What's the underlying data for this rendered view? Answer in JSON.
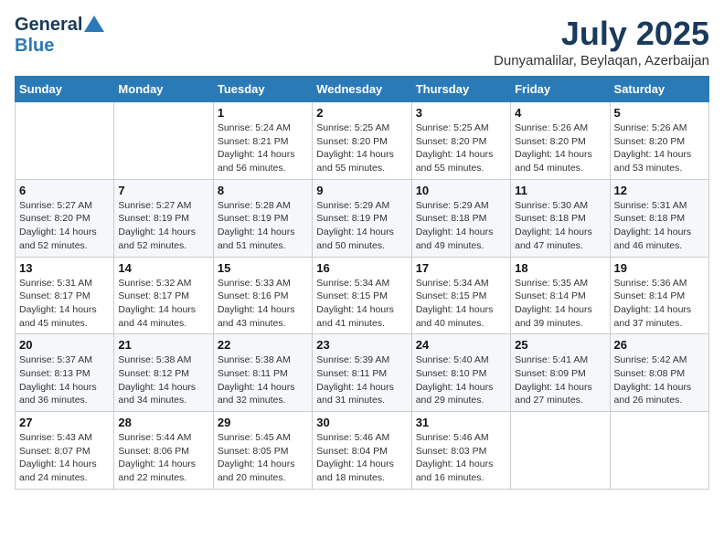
{
  "header": {
    "logo_general": "General",
    "logo_blue": "Blue",
    "month_title": "July 2025",
    "location": "Dunyamalilar, Beylaqan, Azerbaijan"
  },
  "columns": [
    "Sunday",
    "Monday",
    "Tuesday",
    "Wednesday",
    "Thursday",
    "Friday",
    "Saturday"
  ],
  "weeks": [
    [
      {
        "day": "",
        "info": ""
      },
      {
        "day": "",
        "info": ""
      },
      {
        "day": "1",
        "info": "Sunrise: 5:24 AM\nSunset: 8:21 PM\nDaylight: 14 hours and 56 minutes."
      },
      {
        "day": "2",
        "info": "Sunrise: 5:25 AM\nSunset: 8:20 PM\nDaylight: 14 hours and 55 minutes."
      },
      {
        "day": "3",
        "info": "Sunrise: 5:25 AM\nSunset: 8:20 PM\nDaylight: 14 hours and 55 minutes."
      },
      {
        "day": "4",
        "info": "Sunrise: 5:26 AM\nSunset: 8:20 PM\nDaylight: 14 hours and 54 minutes."
      },
      {
        "day": "5",
        "info": "Sunrise: 5:26 AM\nSunset: 8:20 PM\nDaylight: 14 hours and 53 minutes."
      }
    ],
    [
      {
        "day": "6",
        "info": "Sunrise: 5:27 AM\nSunset: 8:20 PM\nDaylight: 14 hours and 52 minutes."
      },
      {
        "day": "7",
        "info": "Sunrise: 5:27 AM\nSunset: 8:19 PM\nDaylight: 14 hours and 52 minutes."
      },
      {
        "day": "8",
        "info": "Sunrise: 5:28 AM\nSunset: 8:19 PM\nDaylight: 14 hours and 51 minutes."
      },
      {
        "day": "9",
        "info": "Sunrise: 5:29 AM\nSunset: 8:19 PM\nDaylight: 14 hours and 50 minutes."
      },
      {
        "day": "10",
        "info": "Sunrise: 5:29 AM\nSunset: 8:18 PM\nDaylight: 14 hours and 49 minutes."
      },
      {
        "day": "11",
        "info": "Sunrise: 5:30 AM\nSunset: 8:18 PM\nDaylight: 14 hours and 47 minutes."
      },
      {
        "day": "12",
        "info": "Sunrise: 5:31 AM\nSunset: 8:18 PM\nDaylight: 14 hours and 46 minutes."
      }
    ],
    [
      {
        "day": "13",
        "info": "Sunrise: 5:31 AM\nSunset: 8:17 PM\nDaylight: 14 hours and 45 minutes."
      },
      {
        "day": "14",
        "info": "Sunrise: 5:32 AM\nSunset: 8:17 PM\nDaylight: 14 hours and 44 minutes."
      },
      {
        "day": "15",
        "info": "Sunrise: 5:33 AM\nSunset: 8:16 PM\nDaylight: 14 hours and 43 minutes."
      },
      {
        "day": "16",
        "info": "Sunrise: 5:34 AM\nSunset: 8:15 PM\nDaylight: 14 hours and 41 minutes."
      },
      {
        "day": "17",
        "info": "Sunrise: 5:34 AM\nSunset: 8:15 PM\nDaylight: 14 hours and 40 minutes."
      },
      {
        "day": "18",
        "info": "Sunrise: 5:35 AM\nSunset: 8:14 PM\nDaylight: 14 hours and 39 minutes."
      },
      {
        "day": "19",
        "info": "Sunrise: 5:36 AM\nSunset: 8:14 PM\nDaylight: 14 hours and 37 minutes."
      }
    ],
    [
      {
        "day": "20",
        "info": "Sunrise: 5:37 AM\nSunset: 8:13 PM\nDaylight: 14 hours and 36 minutes."
      },
      {
        "day": "21",
        "info": "Sunrise: 5:38 AM\nSunset: 8:12 PM\nDaylight: 14 hours and 34 minutes."
      },
      {
        "day": "22",
        "info": "Sunrise: 5:38 AM\nSunset: 8:11 PM\nDaylight: 14 hours and 32 minutes."
      },
      {
        "day": "23",
        "info": "Sunrise: 5:39 AM\nSunset: 8:11 PM\nDaylight: 14 hours and 31 minutes."
      },
      {
        "day": "24",
        "info": "Sunrise: 5:40 AM\nSunset: 8:10 PM\nDaylight: 14 hours and 29 minutes."
      },
      {
        "day": "25",
        "info": "Sunrise: 5:41 AM\nSunset: 8:09 PM\nDaylight: 14 hours and 27 minutes."
      },
      {
        "day": "26",
        "info": "Sunrise: 5:42 AM\nSunset: 8:08 PM\nDaylight: 14 hours and 26 minutes."
      }
    ],
    [
      {
        "day": "27",
        "info": "Sunrise: 5:43 AM\nSunset: 8:07 PM\nDaylight: 14 hours and 24 minutes."
      },
      {
        "day": "28",
        "info": "Sunrise: 5:44 AM\nSunset: 8:06 PM\nDaylight: 14 hours and 22 minutes."
      },
      {
        "day": "29",
        "info": "Sunrise: 5:45 AM\nSunset: 8:05 PM\nDaylight: 14 hours and 20 minutes."
      },
      {
        "day": "30",
        "info": "Sunrise: 5:46 AM\nSunset: 8:04 PM\nDaylight: 14 hours and 18 minutes."
      },
      {
        "day": "31",
        "info": "Sunrise: 5:46 AM\nSunset: 8:03 PM\nDaylight: 14 hours and 16 minutes."
      },
      {
        "day": "",
        "info": ""
      },
      {
        "day": "",
        "info": ""
      }
    ]
  ]
}
